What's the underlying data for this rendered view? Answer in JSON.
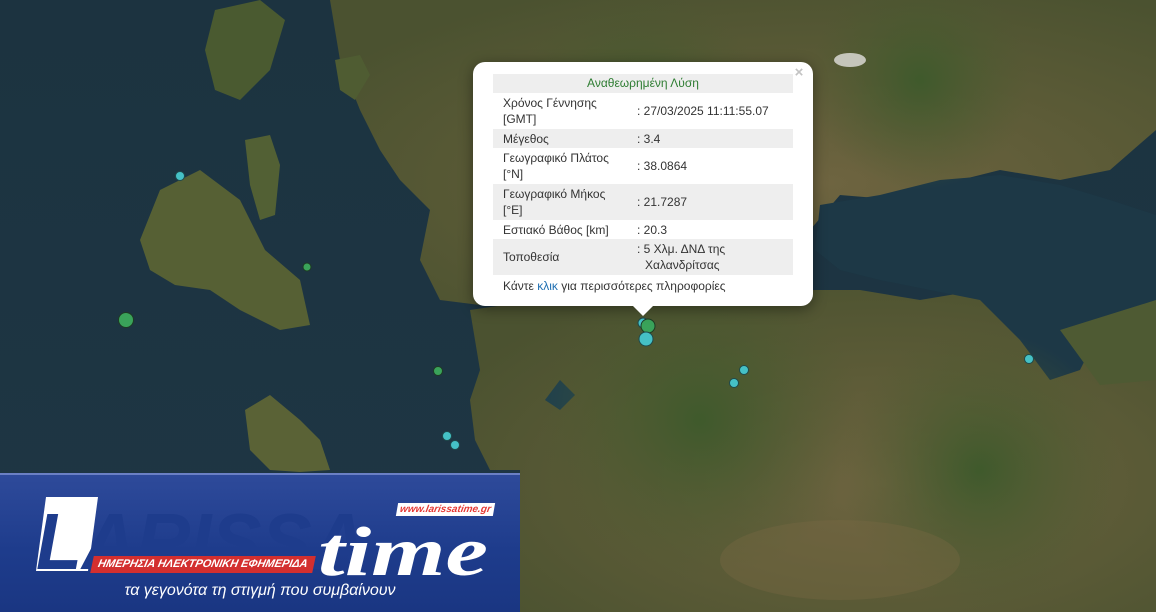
{
  "map": {
    "markers": [
      {
        "id": "m1",
        "color": "#45c1c6",
        "size": "small"
      },
      {
        "id": "m2",
        "color": "#3aa35a",
        "size": "small"
      },
      {
        "id": "m3",
        "color": "#3aa35a",
        "size": "large"
      },
      {
        "id": "m4",
        "color": "#3aa35a",
        "size": "small"
      },
      {
        "id": "m5",
        "color": "#45c1c6",
        "size": "small"
      },
      {
        "id": "m6",
        "color": "#45c1c6",
        "size": "small"
      },
      {
        "id": "m7",
        "color": "#3aa35a",
        "size": "large"
      },
      {
        "id": "m8",
        "color": "#45c1c6",
        "size": "large"
      },
      {
        "id": "m9",
        "color": "#45c1c6",
        "size": "small"
      },
      {
        "id": "m10",
        "color": "#45c1c6",
        "size": "small"
      },
      {
        "id": "m11",
        "color": "#45c1c6",
        "size": "small"
      }
    ]
  },
  "popup": {
    "close_label": "×",
    "title": "Αναθεωρημένη Λύση",
    "rows": [
      {
        "label_line1": "Χρόνος Γέννησης",
        "label_line2": "[GMT]",
        "value": ": 27/03/2025 11:11:55.07"
      },
      {
        "label_line1": "Μέγεθος",
        "value": ": 3.4"
      },
      {
        "label_line1": "Γεωγραφικό Πλάτος",
        "label_line2": "[°N]",
        "value": ": 38.0864"
      },
      {
        "label_line1": "Γεωγραφικό Μήκος",
        "label_line2": "[°E]",
        "value": ": 21.7287"
      },
      {
        "label_line1": "Εστιακό Βάθος [km]",
        "value": ": 20.3"
      },
      {
        "label_line1": "Τοποθεσία",
        "value_line1": ": 5 Χλμ. ΔΝΔ της",
        "value_line2": "Χαλανδρίτσας"
      }
    ],
    "more_prefix": "Κάντε",
    "more_link": "κλικ",
    "more_suffix": "για περισσότερες πληροφορίες"
  },
  "banner": {
    "logo_word": "LARISSA",
    "logo_time": "time",
    "url": "www.larissatime.gr",
    "subtitle": "ΗΜΕΡΗΣΙΑ ΗΛΕΚΤΡΟΝΙΚΗ ΕΦΗΜΕΡΙΔΑ",
    "tagline": "τα γεγονότα τη στιγμή που συμβαίνουν",
    "colors": {
      "primary": "#1e3c8c",
      "accent": "#d32f2f"
    }
  }
}
